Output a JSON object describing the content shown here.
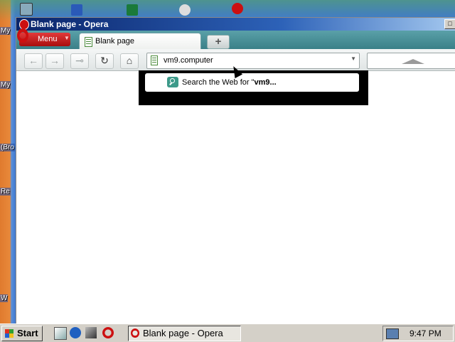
{
  "desktop": {
    "labels": [
      "My",
      "My",
      "(Bro",
      "Re",
      "W"
    ]
  },
  "window": {
    "title": "Blank page - Opera",
    "menu_label": "Menu",
    "menu_arrow": "▼",
    "tab_label": "Blank page",
    "new_tab_label": "+",
    "address_value": "vm9.computer",
    "address_dropdown": "▼",
    "suggestion_prefix": "Search the Web for \"",
    "suggestion_term": "vm9..."
  },
  "nav": {
    "back": "←",
    "forward": "→",
    "key": "⊸",
    "reload": "↻",
    "home": "⌂"
  },
  "taskbar": {
    "start_label": "Start",
    "task_label": "Blank page - Opera",
    "clock": "9:47 PM"
  }
}
